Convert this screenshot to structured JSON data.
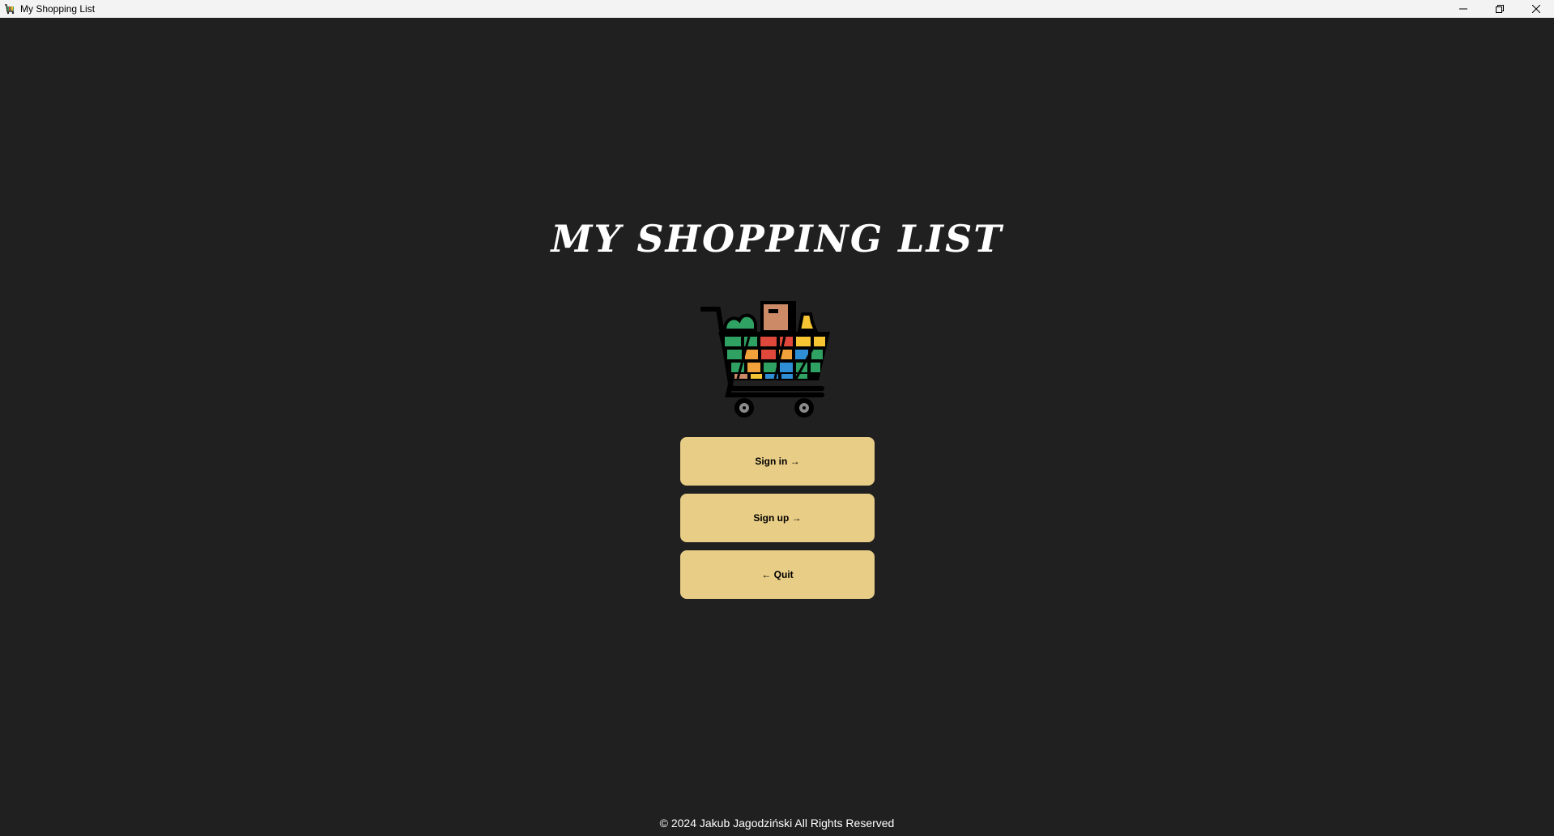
{
  "window": {
    "title": "My Shopping List",
    "icon": "shopping-cart-icon",
    "controls": [
      "minimize-icon",
      "restore-icon",
      "close-icon"
    ]
  },
  "main": {
    "heading": "MY SHOPPING LIST",
    "logo": "shopping-cart-logo",
    "buttons": {
      "sign_in": "Sign in →",
      "sign_up": "Sign up →",
      "quit": "← Quit"
    },
    "footer": "© 2024 Jakub Jagodziński All Rights Reserved"
  },
  "colors": {
    "background": "#202020",
    "button": "#e8cd86",
    "text_light": "#ffffff",
    "text_dark": "#000000"
  }
}
